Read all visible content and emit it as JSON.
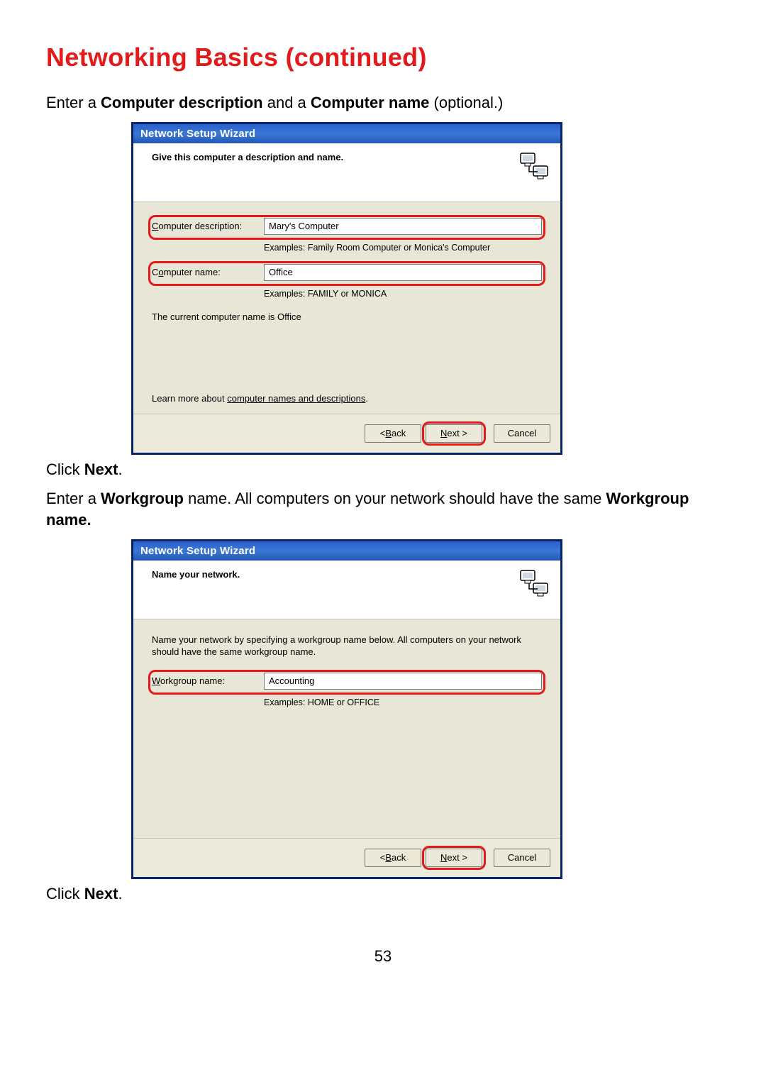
{
  "page": {
    "title": "Networking Basics (continued)",
    "intro1_pre": "Enter a ",
    "intro1_bold1": "Computer description",
    "intro1_mid": " and a ",
    "intro1_bold2": "Computer name",
    "intro1_post": " (optional.)",
    "click_next_pre": "Click ",
    "click_next_bold": "Next",
    "click_next_post": ".",
    "intro2_pre": "Enter a ",
    "intro2_bold1": "Workgroup",
    "intro2_mid": " name.  All computers on your network should have the same ",
    "intro2_bold2": "Workgroup name.",
    "page_number": "53"
  },
  "wizard1": {
    "title": "Network Setup Wizard",
    "header": "Give this computer a description and name.",
    "desc_label_u": "C",
    "desc_label_rest": "omputer description:",
    "desc_value": "Mary's Computer",
    "desc_example": "Examples: Family Room Computer or Monica's Computer",
    "name_label_pre": "C",
    "name_label_u": "o",
    "name_label_post": "mputer name:",
    "name_value": "Office",
    "name_example": "Examples: FAMILY or MONICA",
    "current_name": "The current computer name is Office",
    "learn_pre": "Learn more about ",
    "learn_link": "computer names and descriptions",
    "learn_post": ".",
    "back_lt": "< ",
    "back_u": "B",
    "back_rest": "ack",
    "next_u": "N",
    "next_rest": "ext >",
    "cancel": "Cancel"
  },
  "wizard2": {
    "title": "Network Setup Wizard",
    "header": "Name your network.",
    "intro": "Name your network by specifying a workgroup name below. All computers on your network should have the same workgroup name.",
    "wg_label_u": "W",
    "wg_label_rest": "orkgroup name:",
    "wg_value": "Accounting",
    "wg_example": "Examples: HOME or OFFICE",
    "back_lt": "< ",
    "back_u": "B",
    "back_rest": "ack",
    "next_u": "N",
    "next_rest": "ext >",
    "cancel": "Cancel"
  }
}
